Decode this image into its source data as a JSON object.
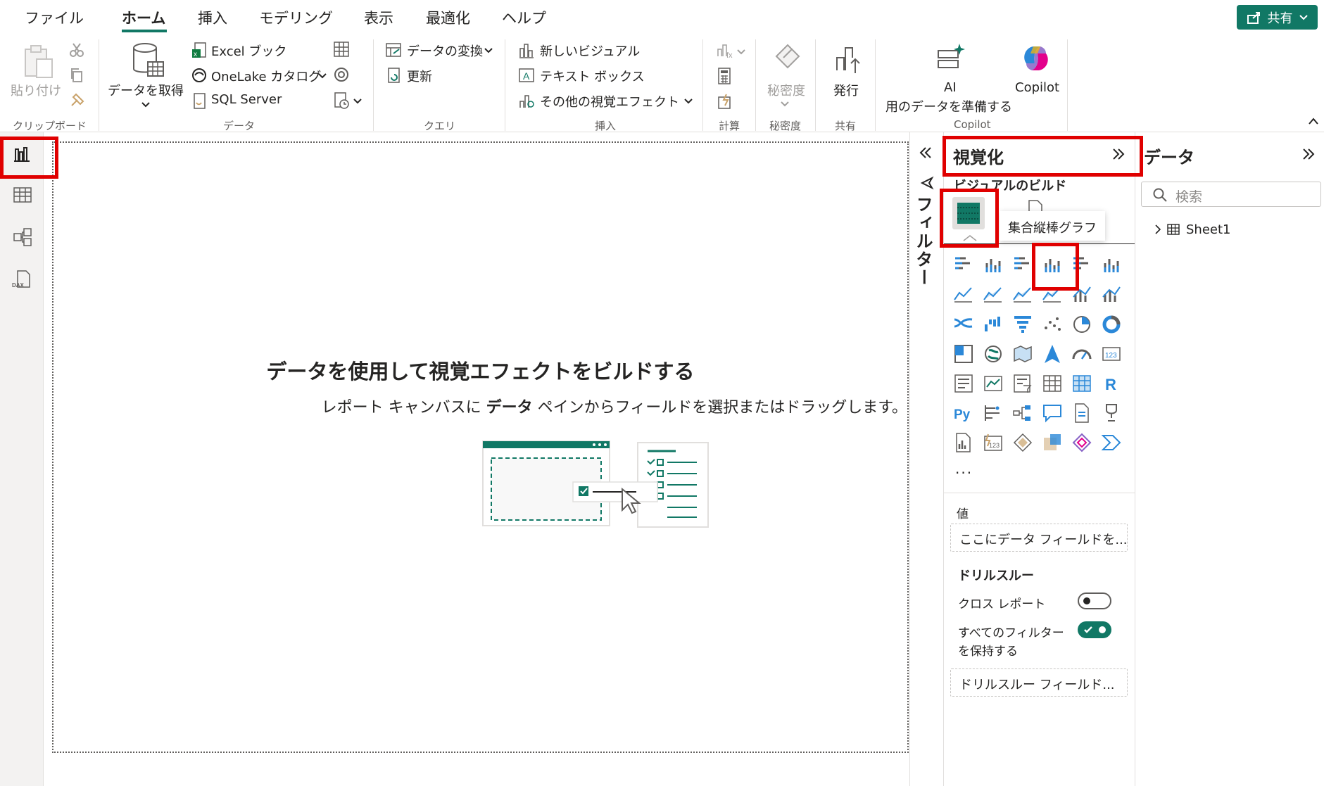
{
  "menu": {
    "tabs": [
      "ファイル",
      "ホーム",
      "挿入",
      "モデリング",
      "表示",
      "最適化",
      "ヘルプ"
    ],
    "active": "ホーム",
    "share_label": "共有"
  },
  "ribbon": {
    "clipboard": {
      "paste": "貼り付け",
      "group": "クリップボード"
    },
    "data": {
      "get_data": "データを取得",
      "excel": "Excel ブック",
      "onelake": "OneLake カタログ",
      "sql": "SQL Server",
      "group": "データ"
    },
    "query": {
      "transform": "データの変換",
      "refresh": "更新",
      "group": "クエリ"
    },
    "insert": {
      "new_visual": "新しいビジュアル",
      "textbox": "テキスト ボックス",
      "more_visuals": "その他の視覚エフェクト",
      "group": "挿入"
    },
    "calc": {
      "group": "計算"
    },
    "sensitivity": {
      "label": "秘密度",
      "group": "秘密度"
    },
    "share": {
      "publish": "発行",
      "group": "共有"
    },
    "copilot": {
      "ai_line1": "AI",
      "ai_line2": "用のデータを準備する",
      "copilot": "Copilot",
      "group": "Copilot"
    }
  },
  "canvas": {
    "title": "データを使用して視覚エフェクトをビルドする",
    "subtitle_before": "レポート キャンバスに ",
    "subtitle_bold": "データ",
    "subtitle_after": " ペインからフィールドを選択またはドラッグします。"
  },
  "filters": {
    "label": "フィルター"
  },
  "viz": {
    "title": "視覚化",
    "build_label": "ビジュアルのビルド",
    "tooltip": "集合縦棒グラフ",
    "more": "...",
    "values_label": "値",
    "values_placeholder": "ここにデータ フィールドを...",
    "drill_label": "ドリルスルー",
    "cross_report": "クロス レポート",
    "keep_filters_1": "すべてのフィルター",
    "keep_filters_2": "を保持する",
    "drill_placeholder": "ドリルスルー フィールド...",
    "cross_report_on": false,
    "keep_filters_on": true
  },
  "data_pane": {
    "title": "データ",
    "search_placeholder": "検索",
    "tables": [
      "Sheet1"
    ]
  },
  "colors": {
    "accent": "#117865",
    "highlight": "#e00000"
  }
}
